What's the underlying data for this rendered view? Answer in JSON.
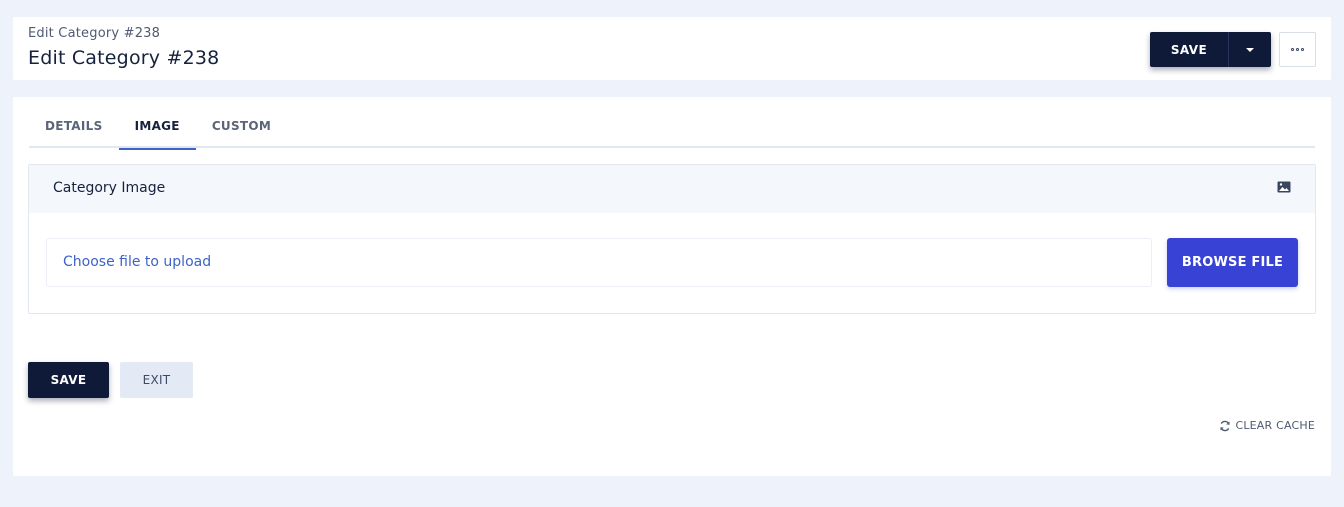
{
  "header": {
    "breadcrumb": "Edit Category #238",
    "title": "Edit Category #238",
    "save_label": "SAVE",
    "dropdown_icon": "caret-down-icon",
    "more_icon": "more-dots-icon"
  },
  "tabs": [
    {
      "label": "DETAILS",
      "active": false
    },
    {
      "label": "IMAGE",
      "active": true
    },
    {
      "label": "CUSTOM",
      "active": false
    }
  ],
  "image_panel": {
    "title": "Category Image",
    "icon": "image-icon",
    "file_placeholder": "Choose file to upload",
    "browse_label": "BROWSE FILE"
  },
  "actions": {
    "save_label": "SAVE",
    "exit_label": "EXIT"
  },
  "footer": {
    "clear_cache_label": "CLEAR CACHE",
    "clear_cache_icon": "refresh-icon"
  },
  "colors": {
    "page_bg": "#eef2fa",
    "primary_dark": "#0e1a38",
    "accent_blue": "#3d63c9",
    "browse_blue": "#3843d6"
  }
}
